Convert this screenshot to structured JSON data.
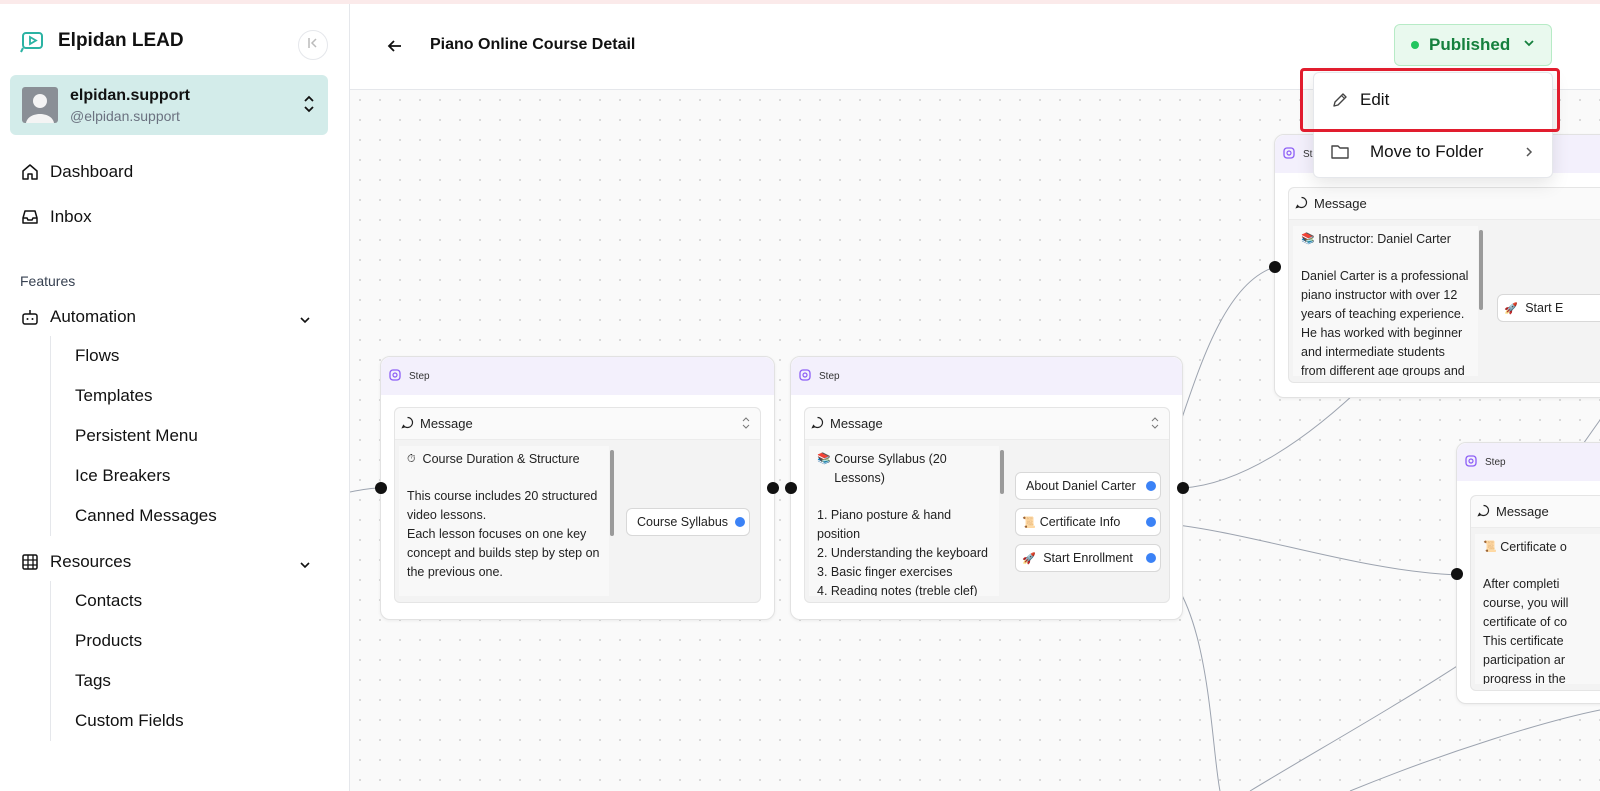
{
  "sidebar": {
    "brand": "Elpidan LEAD",
    "account": {
      "name": "elpidan.support",
      "handle": "@elpidan.support"
    },
    "nav": [
      {
        "label": "Dashboard",
        "icon": "home-icon"
      },
      {
        "label": "Inbox",
        "icon": "inbox-icon"
      }
    ],
    "features_label": "Features",
    "automation": {
      "label": "Automation",
      "items": [
        "Flows",
        "Templates",
        "Persistent Menu",
        "Ice Breakers",
        "Canned Messages"
      ]
    },
    "resources": {
      "label": "Resources",
      "items": [
        "Contacts",
        "Products",
        "Tags",
        "Custom Fields"
      ]
    }
  },
  "header": {
    "title": "Piano Online Course Detail",
    "status": "Published"
  },
  "dropdown": {
    "edit": "Edit",
    "move": "Move to Folder"
  },
  "canvas": {
    "step_label": "Step",
    "step_label_cut": "Ste",
    "message_label": "Message",
    "node1": {
      "title": "Course Duration & Structure",
      "body": "This course includes 20 structured video lessons.\nEach lesson focuses on one key concept and builds step by step on the previous one.",
      "button": "Course Syllabus"
    },
    "node2": {
      "title": "Course Syllabus (20 Lessons)",
      "body": "1. Piano posture & hand position\n2. Understanding the keyboard\n3. Basic finger exercises\n4. Reading notes (treble clef)",
      "buttons": [
        "About Daniel Carter",
        "Certificate Info",
        "Start Enrollment"
      ]
    },
    "node3": {
      "title": "Instructor: Daniel Carter",
      "body": "Daniel Carter is a professional piano instructor with over 12 years of teaching experience. He has worked with beginner and intermediate students from different age groups and",
      "button": "Start E"
    },
    "node4": {
      "title": "Certificate o",
      "body": "After completi\ncourse, you will\ncertificate of co\nThis certificate\nparticipation ar\nprogress in the"
    }
  },
  "colors": {
    "accent_teal": "#d3ecea",
    "published_green": "#15803d",
    "highlight_red": "#e11d2e",
    "port_blue": "#3b82f6"
  }
}
